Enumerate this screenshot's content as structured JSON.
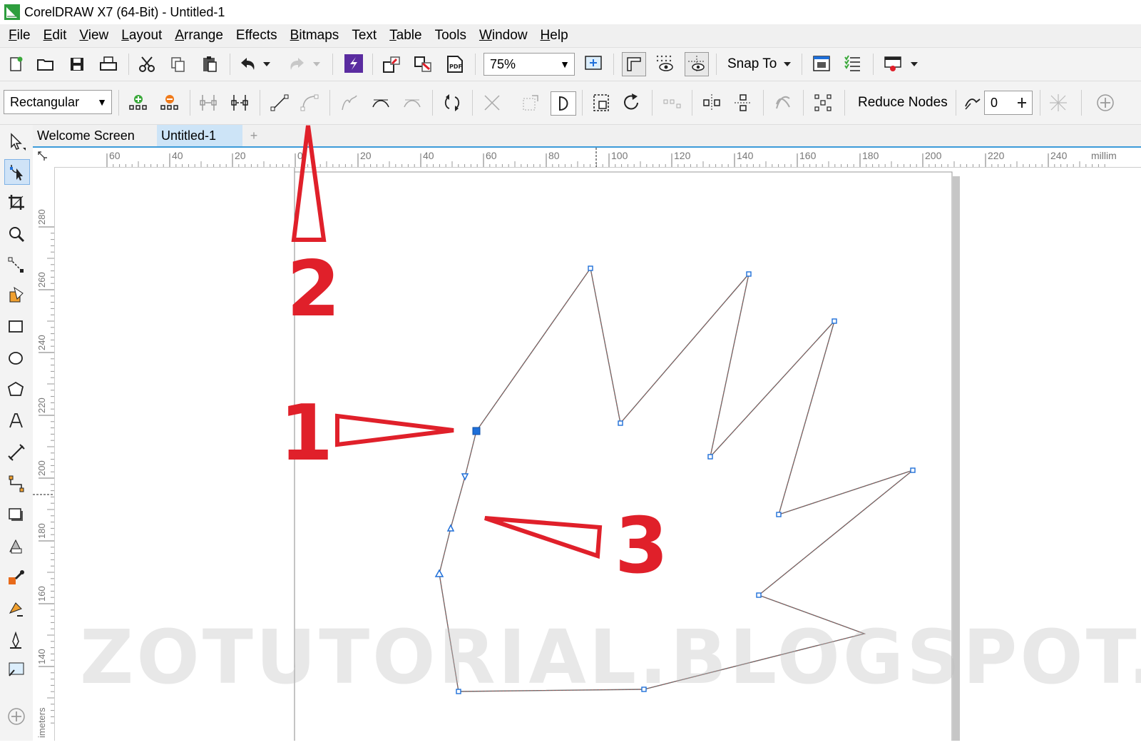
{
  "window": {
    "title": "CorelDRAW X7 (64-Bit) - Untitled-1"
  },
  "menu": [
    {
      "label": "File",
      "key": "F",
      "rest": "ile"
    },
    {
      "label": "Edit",
      "key": "E",
      "rest": "dit"
    },
    {
      "label": "View",
      "key": "V",
      "rest": "iew"
    },
    {
      "label": "Layout",
      "key": "L",
      "rest": "ayout"
    },
    {
      "label": "Arrange",
      "key": "A",
      "rest": "rrange"
    },
    {
      "label": "Effects",
      "key": "",
      "rest": "Effects"
    },
    {
      "label": "Bitmaps",
      "key": "B",
      "rest": "itmaps"
    },
    {
      "label": "Text",
      "key": "",
      "rest": "Text"
    },
    {
      "label": "Table",
      "key": "T",
      "rest": "able"
    },
    {
      "label": "Tools",
      "key": "",
      "rest": "Tools"
    },
    {
      "label": "Window",
      "key": "W",
      "rest": "indow"
    },
    {
      "label": "Help",
      "key": "H",
      "rest": "elp"
    }
  ],
  "toolbar": {
    "zoom_value": "75%",
    "snap_to_label": "Snap To"
  },
  "property_bar": {
    "selection_mode": "Rectangular",
    "reduce_nodes_label": "Reduce Nodes",
    "curve_smoothness_value": "0"
  },
  "tabs": [
    {
      "label": "Welcome Screen",
      "active": false
    },
    {
      "label": "Untitled-1",
      "active": true
    }
  ],
  "ruler": {
    "horizontal_ticks": [
      "60",
      "40",
      "20",
      "0",
      "20",
      "40",
      "60",
      "80",
      "100",
      "120",
      "140",
      "160",
      "180",
      "200",
      "220",
      "240"
    ],
    "unit_label": "millim",
    "vertical_ticks": [
      "280",
      "260",
      "240",
      "220",
      "200",
      "180",
      "160",
      "140"
    ],
    "vertical_unit_label": "imeters"
  },
  "annotations": {
    "label_1": "1",
    "label_2": "2",
    "label_3": "3"
  },
  "watermark": "ZOTUTORIAL.BLOGSPOT.COM",
  "colors": {
    "annotation_red": "#e0202a",
    "node_blue": "#1e6fd9",
    "tab_accent": "#3d9bd9"
  }
}
